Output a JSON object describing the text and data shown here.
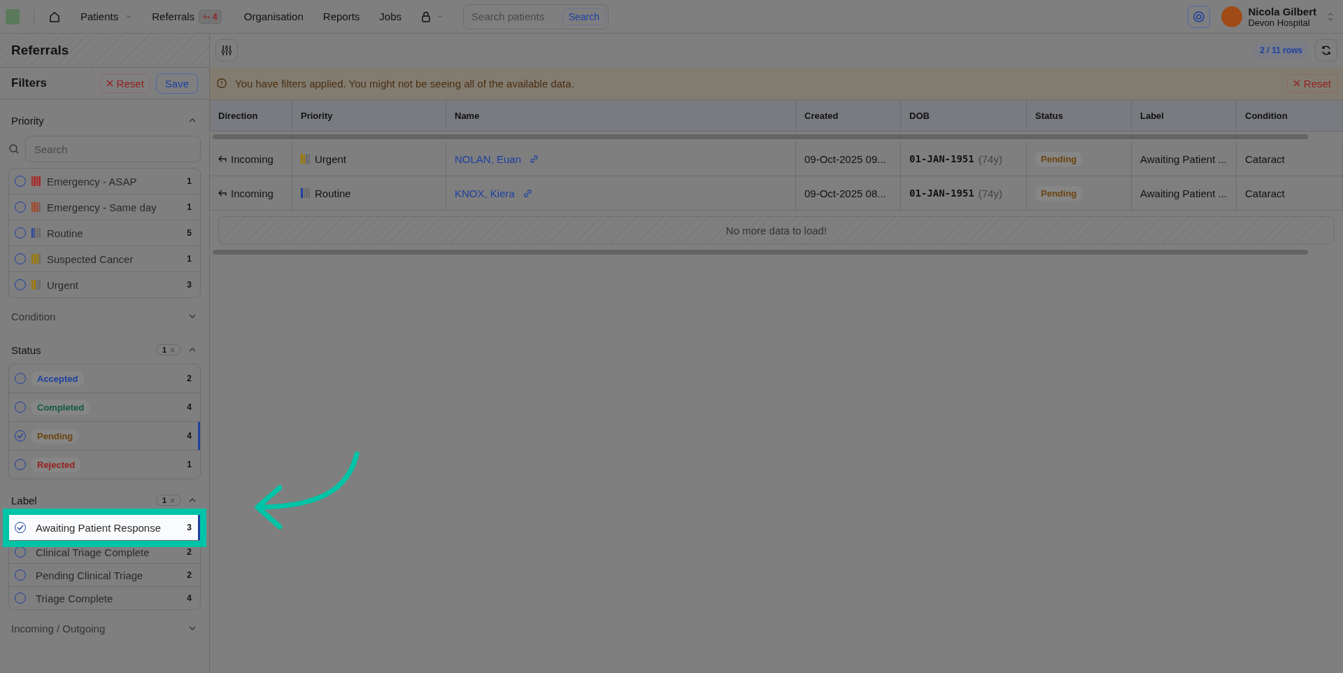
{
  "top_bar": {
    "nav": [
      {
        "kind": "home"
      },
      {
        "kind": "menu",
        "label": "Patients"
      },
      {
        "kind": "link",
        "label": "Referrals",
        "badge": "4"
      },
      {
        "kind": "link",
        "label": "Organisation"
      },
      {
        "kind": "link",
        "label": "Reports"
      },
      {
        "kind": "link",
        "label": "Jobs"
      },
      {
        "kind": "lock"
      }
    ],
    "search": {
      "placeholder": "Search patients",
      "button": "Search"
    },
    "user": {
      "name": "Nicola Gilbert",
      "organisation": "Devon Hospital"
    }
  },
  "sidebar": {
    "title": "Referrals",
    "filters_title": "Filters",
    "reset": "Reset",
    "save": "Save",
    "sections": [
      {
        "kind": "priority",
        "title": "Priority",
        "expanded": true,
        "search_placeholder": "Search",
        "items": [
          {
            "label": "Emergency - ASAP",
            "count": "1",
            "checked": false,
            "level": 1,
            "color": "#a82a2a"
          },
          {
            "label": "Emergency - Same day",
            "count": "1",
            "checked": false,
            "level": 0.75,
            "color": "#a3472a"
          },
          {
            "label": "Routine",
            "count": "5",
            "checked": false,
            "level": 0.25,
            "color": "#1e40a0"
          },
          {
            "label": "Suspected Cancer",
            "count": "1",
            "checked": false,
            "level": 0.75,
            "color": "#9c7a08"
          },
          {
            "label": "Urgent",
            "count": "3",
            "checked": false,
            "level": 0.5,
            "color": "#9c7a08"
          }
        ]
      },
      {
        "kind": "plain",
        "title": "Condition",
        "expanded": false
      },
      {
        "kind": "status",
        "title": "Status",
        "expanded": true,
        "badge": "1",
        "items": [
          {
            "label": "Accepted",
            "count": "2",
            "checked": false,
            "color": "#1e40a0"
          },
          {
            "label": "Completed",
            "count": "4",
            "checked": false,
            "color": "#145c45"
          },
          {
            "label": "Pending",
            "count": "4",
            "checked": true,
            "color": "#6b4510"
          },
          {
            "label": "Rejected",
            "count": "1",
            "checked": false,
            "color": "#962020"
          }
        ]
      },
      {
        "kind": "label",
        "title": "Label",
        "expanded": true,
        "badge": "1",
        "items": [
          {
            "label": "Awaiting Patient Response",
            "count": "3",
            "checked": true,
            "highlighted": true
          },
          {
            "label": "Clinical Triage Complete",
            "count": "2",
            "checked": false,
            "highlighted": false
          },
          {
            "label": "Pending Clinical Triage",
            "count": "2",
            "checked": false,
            "highlighted": false
          },
          {
            "label": "Triage Complete",
            "count": "4",
            "checked": false,
            "highlighted": false
          }
        ]
      },
      {
        "kind": "plain",
        "title": "Incoming / Outgoing",
        "expanded": false
      }
    ]
  },
  "main": {
    "rows_count": "2 / 11 rows",
    "alert": "You have filters applied. You might not be seeing all of the available data.",
    "alert_reset": "Reset",
    "table": {
      "columns": [
        "Direction",
        "Priority",
        "Name",
        "Created",
        "DOB",
        "Status",
        "Label",
        "Condition"
      ],
      "rows": [
        {
          "direction": "Incoming",
          "priority": {
            "label": "Urgent",
            "level": 0.5,
            "color": "#9c7a08"
          },
          "name": "NOLAN, Euan",
          "created": "09-Oct-2025 09...",
          "dob": "01-JAN-1951",
          "age": "(74y)",
          "status": {
            "label": "Pending",
            "color": "#6b4510"
          },
          "label": "Awaiting Patient ...",
          "condition": "Cataract"
        },
        {
          "direction": "Incoming",
          "priority": {
            "label": "Routine",
            "level": 0.25,
            "color": "#1e40a0"
          },
          "name": "KNOX, Kiera",
          "created": "09-Oct-2025 08...",
          "dob": "01-JAN-1951",
          "age": "(74y)",
          "status": {
            "label": "Pending",
            "color": "#6b4510"
          },
          "label": "Awaiting Patient ...",
          "condition": "Cataract"
        }
      ],
      "footer": "No more data to load!"
    }
  }
}
